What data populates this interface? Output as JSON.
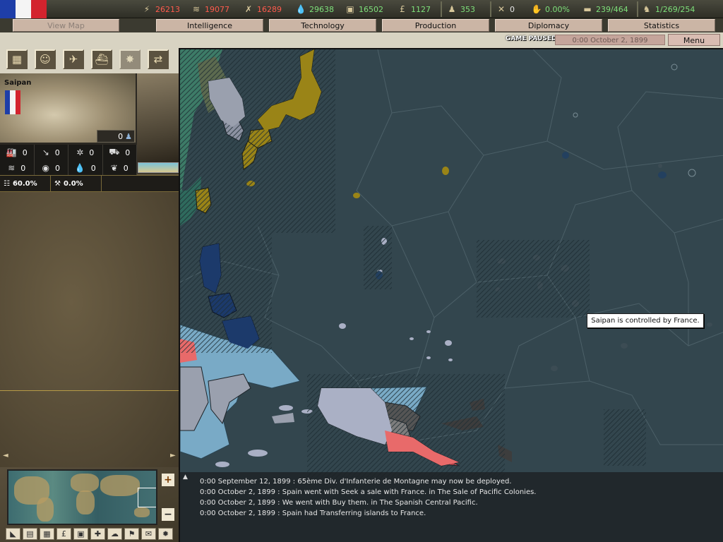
{
  "resources": [
    {
      "name": "energy",
      "icon": "⚡",
      "value": "26213",
      "color": "red"
    },
    {
      "name": "metal",
      "icon": "≋",
      "value": "19077",
      "color": "red"
    },
    {
      "name": "rare-materials",
      "icon": "✗",
      "value": "16289",
      "color": "red"
    },
    {
      "name": "oil",
      "icon": "💧",
      "value": "29638",
      "color": "green"
    },
    {
      "name": "supplies",
      "icon": "▣",
      "value": "16502",
      "color": "green"
    },
    {
      "name": "money",
      "icon": "£",
      "value": "1127",
      "color": "green"
    }
  ],
  "indicators": [
    {
      "name": "manpower",
      "icon": "♟",
      "value": "353",
      "color": "green"
    },
    {
      "name": "transports",
      "icon": "✕",
      "value": "0",
      "color": "white"
    },
    {
      "name": "dissent",
      "icon": "✋",
      "value": "0.00%",
      "color": "green"
    },
    {
      "name": "ic",
      "icon": "▬",
      "value": "239/464",
      "color": "green"
    },
    {
      "name": "convoys",
      "icon": "♞",
      "value": "1/269/254",
      "color": "green"
    }
  ],
  "tabs": {
    "view_map": "View Map",
    "intelligence": "Intelligence",
    "technology": "Technology",
    "production": "Production",
    "diplomacy": "Diplomacy",
    "statistics": "Statistics"
  },
  "status": {
    "paused": "GAME PAUSED",
    "date": "0:00 October 2, 1899",
    "menu": "Menu"
  },
  "province": {
    "name": "Saipan",
    "manpower": "0",
    "stats_row1": [
      {
        "icon": "🏭",
        "name": "industry",
        "value": "0"
      },
      {
        "icon": "↘",
        "name": "infrastructure",
        "value": "0"
      },
      {
        "icon": "✲",
        "name": "anti-air",
        "value": "0"
      },
      {
        "icon": "⛟",
        "name": "coastal-fort",
        "value": "0"
      }
    ],
    "stats_row2": [
      {
        "icon": "≋",
        "name": "metal",
        "value": "0"
      },
      {
        "icon": "◉",
        "name": "energy",
        "value": "0"
      },
      {
        "icon": "💧",
        "name": "oil",
        "value": "0"
      },
      {
        "icon": "❦",
        "name": "rare",
        "value": "0"
      }
    ],
    "pct1": "60.0%",
    "pct2": "0.0%"
  },
  "tooltip": "Saipan is controlled by France.",
  "log": [
    "0:00 September 12, 1899 : 65ème Div. d'Infanterie de Montagne may now be deployed.",
    "0:00 October 2, 1899 : Spain went with Seek a sale with France. in The Sale of Pacific Colonies.",
    "0:00 October 2, 1899 : We went with Buy them. in The Spanish Central Pacific.",
    "0:00 October 2, 1899 : Spain had Transferring islands to France."
  ],
  "colors": {
    "ocean": "#2e4048",
    "japan": "#9a8417",
    "korea": "#9a9fae",
    "spain": "#1c3a6b",
    "netherlands": "#79aac6",
    "germany": "#6a6a6a",
    "britain": "#e86a6a",
    "france_islands": "#aab0c5"
  }
}
